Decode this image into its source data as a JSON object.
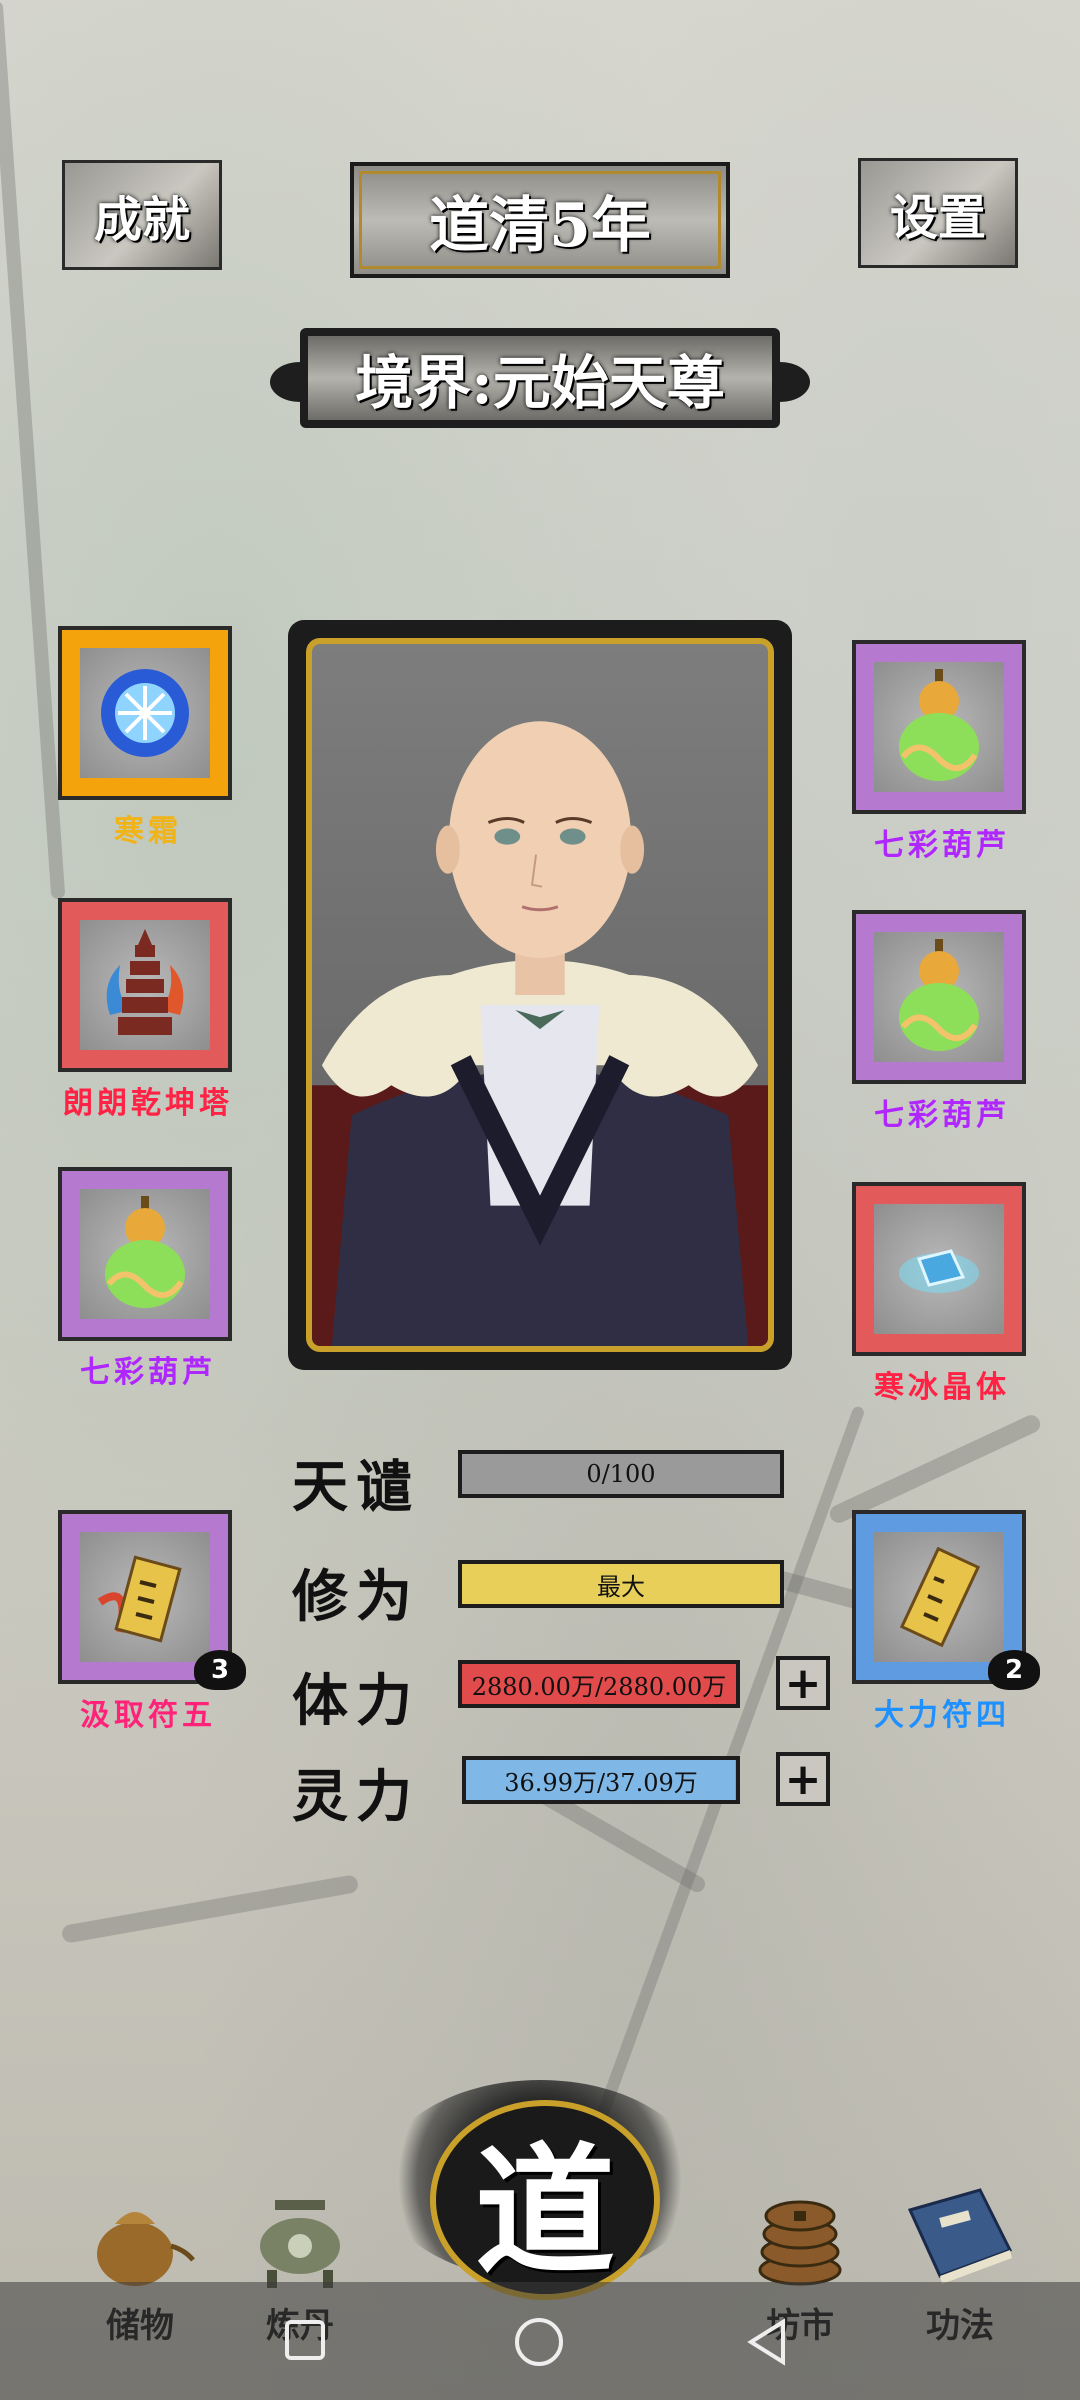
{
  "header": {
    "achievements_label": "成就",
    "year_label": "道清5年",
    "settings_label": "设置",
    "realm_label": "境界:元始天尊"
  },
  "items_left": [
    {
      "label": "寒霜",
      "color": "#f0b419",
      "frame": "#f5a30c"
    },
    {
      "label": "朗朗乾坤塔",
      "color": "#ff2244",
      "frame": "#e25a5a"
    },
    {
      "label": "七彩葫芦",
      "color": "#b026ff",
      "frame": "#b57ad0"
    },
    {
      "label": "汲取符五",
      "color": "#ff2278",
      "frame": "#b57ad0",
      "count": "3"
    }
  ],
  "items_right": [
    {
      "label": "七彩葫芦",
      "color": "#b026ff",
      "frame": "#b57ad0"
    },
    {
      "label": "七彩葫芦",
      "color": "#b026ff",
      "frame": "#b57ad0"
    },
    {
      "label": "寒冰晶体",
      "color": "#ff2244",
      "frame": "#e25a5a"
    },
    {
      "label": "大力符四",
      "color": "#1e90ff",
      "frame": "#5f9be0",
      "count": "2"
    }
  ],
  "stats": {
    "tianqian": {
      "label": "天谴",
      "value": "0/100",
      "fill": 0,
      "color": "#7c7c7c"
    },
    "xiuwei": {
      "label": "修为",
      "value": "最大",
      "fill": 1,
      "color": "#e8cf5a"
    },
    "tili": {
      "label": "体力",
      "value": "2880.00万/2880.00万",
      "fill": 1,
      "color": "#e24b4b"
    },
    "lingli": {
      "label": "灵力",
      "value": "36.99万/37.09万",
      "fill": 0.997,
      "color": "#7fb8e6"
    }
  },
  "nav": {
    "storage": "储物",
    "refine": "炼丹",
    "center": "道",
    "market": "坊市",
    "skills": "功法"
  }
}
